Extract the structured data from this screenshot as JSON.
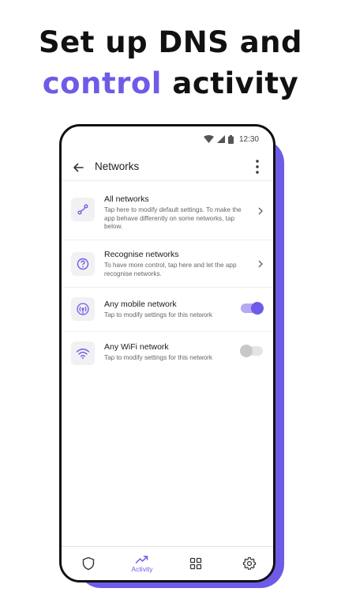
{
  "headline": {
    "line1": "Set up DNS and",
    "accent": "control",
    "rest": " activity"
  },
  "status_bar": {
    "time": "12:30"
  },
  "app_bar": {
    "title": "Networks"
  },
  "networks": [
    {
      "title": "All networks",
      "description": "Tap here to modify default settings. To make the app behave differently on some networks, tap below.",
      "icon": "share-nodes-icon",
      "control": "chevron"
    },
    {
      "title": "Recognise networks",
      "description": "To have more control, tap here and let the app recognise networks.",
      "icon": "question-circle-icon",
      "control": "chevron"
    },
    {
      "title": "Any mobile network",
      "description": "Tap to modify settings for this network",
      "icon": "cell-tower-icon",
      "control": "toggle",
      "enabled": true
    },
    {
      "title": "Any WiFi network",
      "description": "Tap to modify settings for this network",
      "icon": "wifi-icon",
      "control": "toggle",
      "enabled": false
    }
  ],
  "bottom_nav": {
    "items": [
      {
        "icon": "shield-icon",
        "label": ""
      },
      {
        "icon": "trending-up-icon",
        "label": "Activity",
        "active": true
      },
      {
        "icon": "grid-icon",
        "label": ""
      },
      {
        "icon": "gear-icon",
        "label": ""
      }
    ]
  },
  "colors": {
    "accent": "#6c5ce7",
    "text": "#111111"
  }
}
